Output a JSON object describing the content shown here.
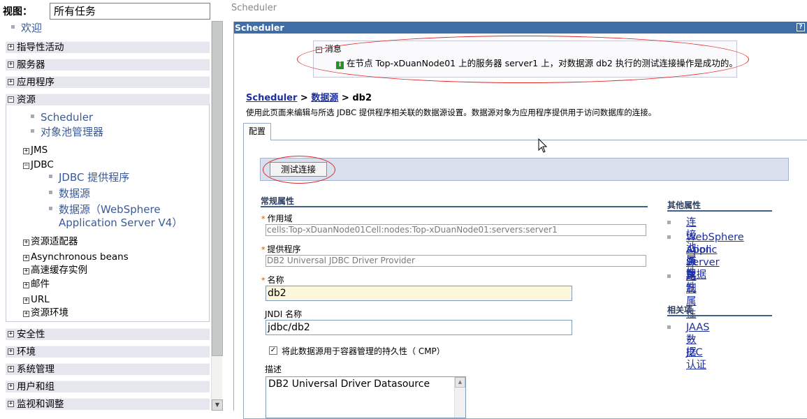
{
  "nav": {
    "view_label": "视图：",
    "view_value": "所有任务",
    "welcome": "欢迎",
    "sections": [
      {
        "label": "指导性活动",
        "expander": "+"
      },
      {
        "label": "服务器",
        "expander": "+"
      },
      {
        "label": "应用程序",
        "expander": "+"
      },
      {
        "label": "资源",
        "expander": "−"
      },
      {
        "label": "安全性",
        "expander": "+"
      },
      {
        "label": "环境",
        "expander": "+"
      },
      {
        "label": "系统管理",
        "expander": "+"
      },
      {
        "label": "用户和组",
        "expander": "+"
      },
      {
        "label": "监视和调整",
        "expander": "+"
      }
    ],
    "resources": {
      "leaves_top": [
        "Scheduler",
        "对象池管理器"
      ],
      "jms": "JMS",
      "jdbc": "JDBC",
      "jdbc_leaves": [
        "JDBC 提供程序",
        "数据源",
        "数据源（WebSphere",
        "Application Server V4）"
      ],
      "others": [
        "资源适配器",
        "Asynchronous beans",
        "高速缓存实例",
        "邮件",
        "URL",
        "资源环境"
      ]
    }
  },
  "header": {
    "top_crumb": "Scheduler",
    "title": "Scheduler",
    "help": "?"
  },
  "message": {
    "head": "消息",
    "text": "在节点 Top-xDuanNode01 上的服务器 server1 上，对数据源 db2 执行的测试连接操作是成功的。"
  },
  "breadcrumb": {
    "root": "Scheduler",
    "sep": ">",
    "mid": "数据源",
    "current": "db2"
  },
  "page_desc": "使用此页面来编辑与所选 JDBC 提供程序相关联的数据源设置。数据源对象为应用程序提供用于访问数据库的连接。",
  "tab": "配置",
  "test_button": "测试连接",
  "general": {
    "heading": "常规属性",
    "scope_label": "作用域",
    "scope_value": "cells:Top-xDuanNode01Cell:nodes:Top-xDuanNode01:servers:server1",
    "provider_label": "提供程序",
    "provider_value": "DB2 Universal JDBC Driver Provider",
    "name_label": "名称",
    "name_value": "db2",
    "jndi_label": "JNDI 名称",
    "jndi_value": "jdbc/db2",
    "cmp_label": "将此数据源用于容器管理的持久性（ CMP）",
    "desc_label": "描述",
    "desc_value": "DB2 Universal Driver Datasource"
  },
  "other": {
    "heading": "其他属性",
    "links": [
      "连接池属性",
      "WebSphere Applic",
      "ation Server 数据",
      "源属性",
      "定制属性"
    ]
  },
  "related": {
    "heading": "相关项",
    "links": [
      "JAAS － J2C 认证",
      "数据"
    ]
  },
  "colors": {
    "titlebar": "#3f6ea6",
    "link": "#1d2ea0",
    "annotation": "#e32424"
  }
}
